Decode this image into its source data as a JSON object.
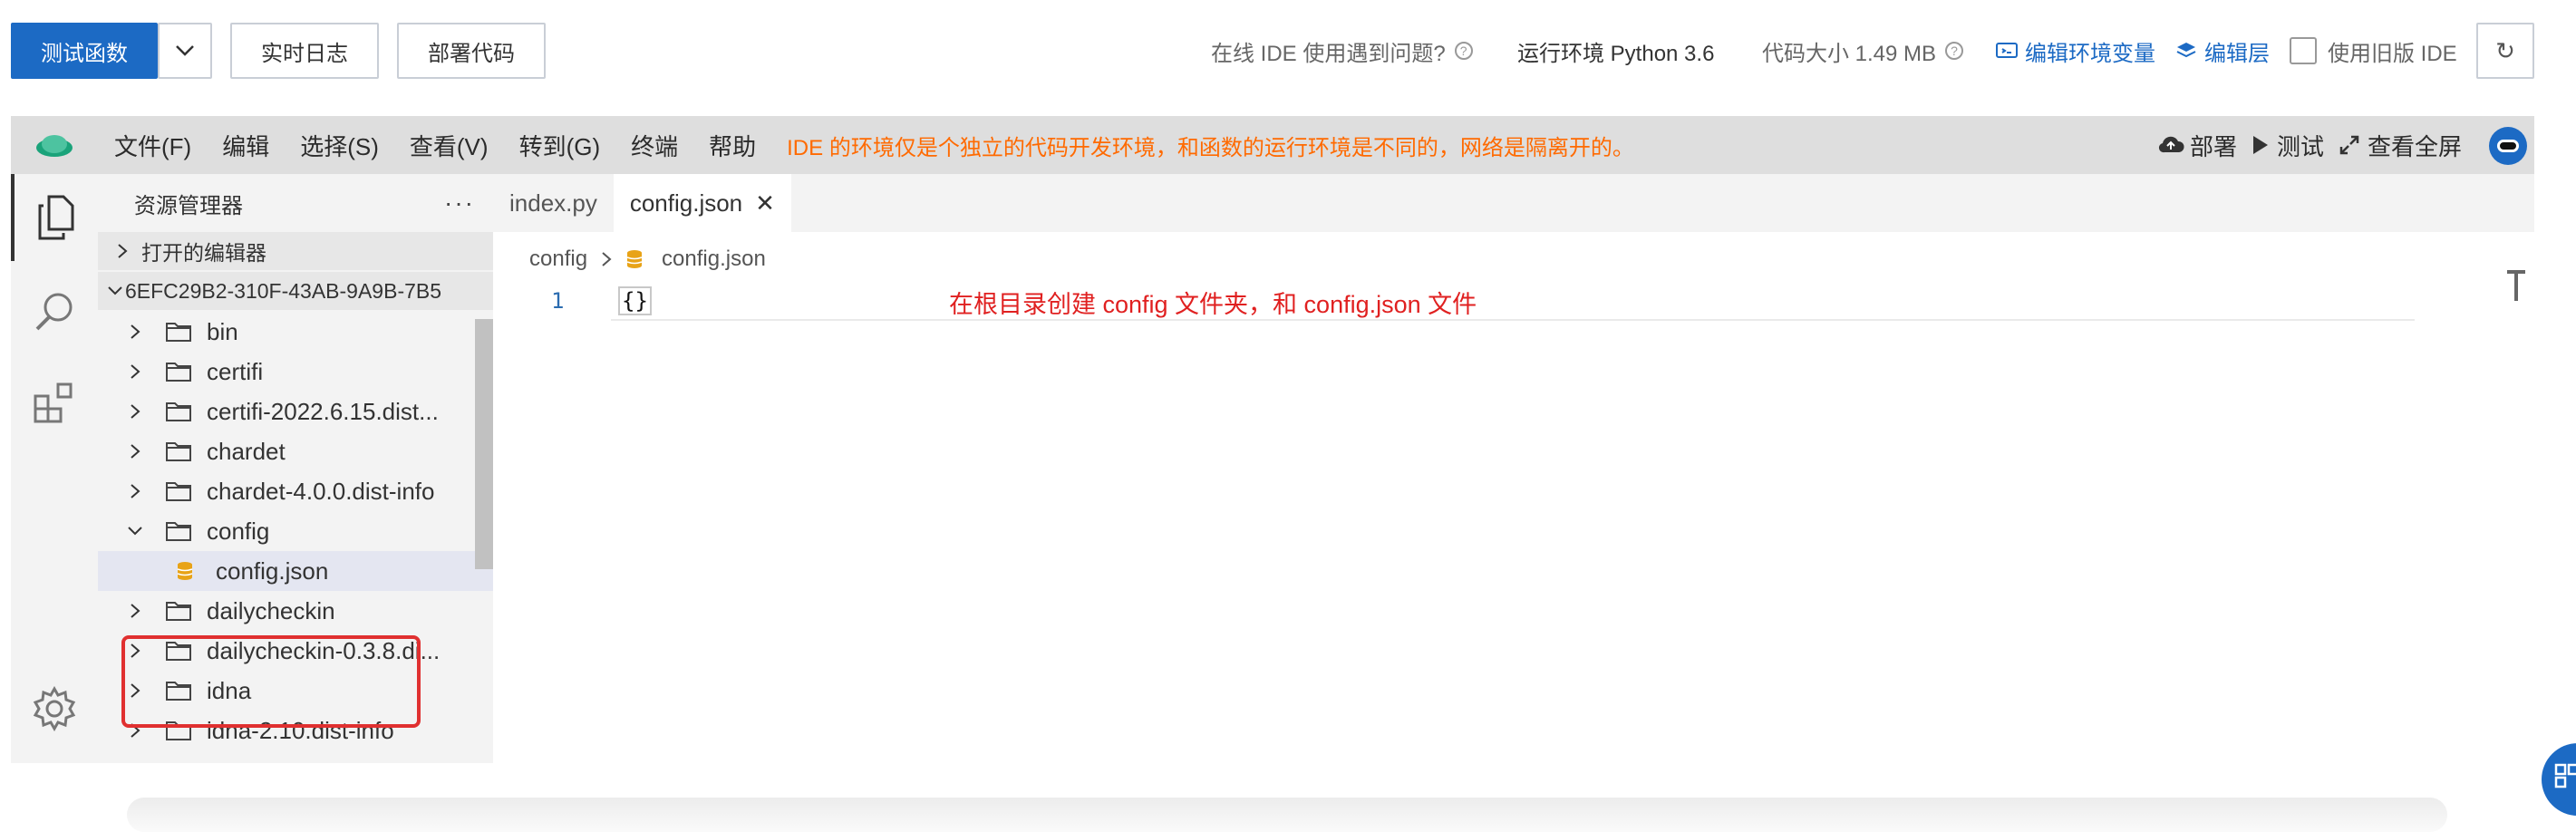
{
  "toolbar": {
    "test_function_label": "测试函数",
    "realtime_log_label": "实时日志",
    "deploy_code_label": "部署代码",
    "ide_problem_text": "在线 IDE 使用遇到问题?",
    "runtime_label": "运行环境 Python 3.6",
    "code_size_label": "代码大小 1.49 MB",
    "edit_env_vars_label": "编辑环境变量",
    "edit_layer_label": "编辑层",
    "use_old_ide_label": "使用旧版 IDE",
    "refresh_symbol": "↻"
  },
  "menubar": {
    "items": [
      "文件(F)",
      "编辑",
      "选择(S)",
      "查看(V)",
      "转到(G)",
      "终端",
      "帮助"
    ],
    "notice": "IDE 的环境仅是个独立的代码开发环境，和函数的运行环境是不同的，网络是隔离开的。",
    "deploy_label": "部署",
    "test_label": "测试",
    "fullscreen_label": "查看全屏"
  },
  "explorer": {
    "title": "资源管理器",
    "more": "···",
    "open_editors_label": "打开的编辑器",
    "root_label": "6EFC29B2-310F-43AB-9A9B-7B5",
    "items": [
      {
        "label": "bin"
      },
      {
        "label": "certifi"
      },
      {
        "label": "certifi-2022.6.15.dist..."
      },
      {
        "label": "chardet"
      },
      {
        "label": "chardet-4.0.0.dist-info"
      },
      {
        "label": "config"
      },
      {
        "label": "config.json"
      },
      {
        "label": "dailycheckin"
      },
      {
        "label": "dailycheckin-0.3.8.di..."
      },
      {
        "label": "idna"
      },
      {
        "label": "idna-2.10.dist-info"
      }
    ]
  },
  "editor": {
    "tabs": [
      {
        "label": "index.py"
      },
      {
        "label": "config.json"
      }
    ],
    "breadcrumb": {
      "folder": "config",
      "file": "config.json"
    },
    "line_number": "1",
    "code": "{}",
    "annotation": "在根目录创建 config 文件夹，和 config.json 文件"
  },
  "colors": {
    "primary_blue": "#1c6ac4",
    "notice_orange": "#ff6a00",
    "annotation_red": "#e02020"
  }
}
